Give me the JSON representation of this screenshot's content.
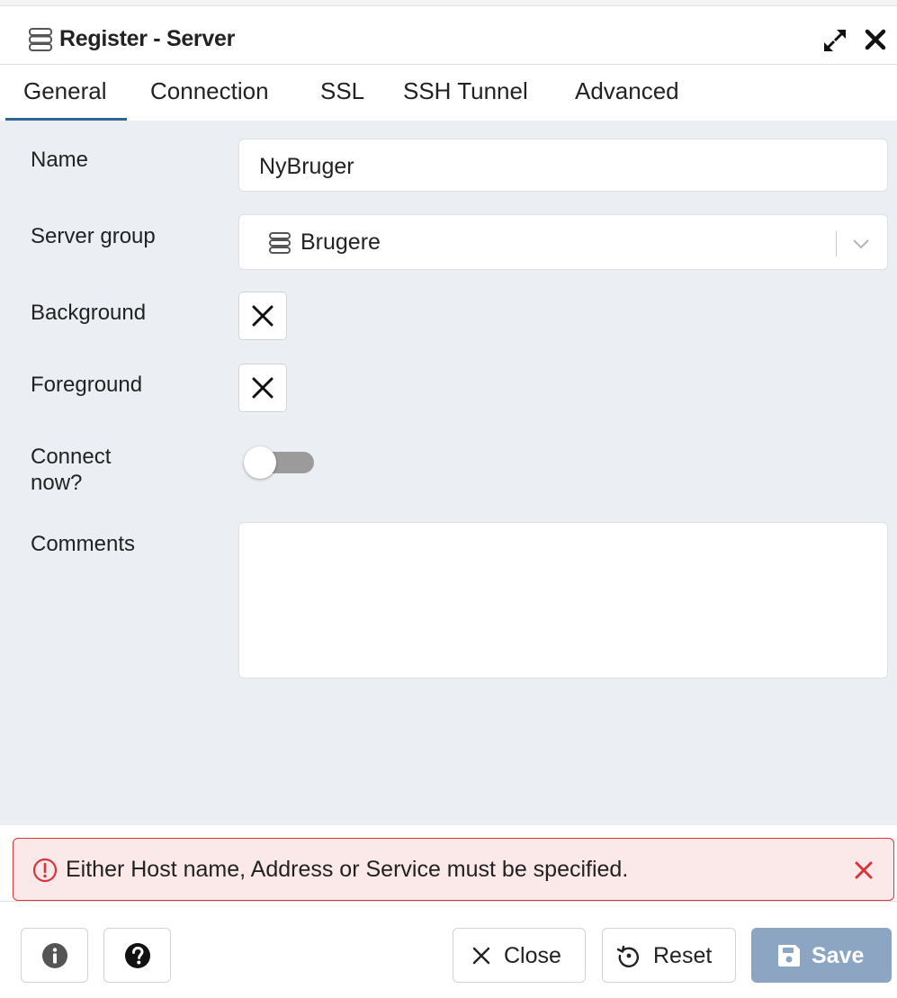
{
  "dialog": {
    "title": "Register - Server",
    "title_icon": "server-icon",
    "controls": [
      "expand-icon",
      "close-icon"
    ]
  },
  "tabs": [
    {
      "label": "General",
      "active": true
    },
    {
      "label": "Connection",
      "active": false
    },
    {
      "label": "SSL",
      "active": false
    },
    {
      "label": "SSH Tunnel",
      "active": false
    },
    {
      "label": "Advanced",
      "active": false
    }
  ],
  "form": {
    "name_label": "Name",
    "name_value": "NyBruger",
    "server_group_label": "Server group",
    "server_group_value": "Brugere",
    "background_label": "Background",
    "foreground_label": "Foreground",
    "connect_now_label_line1": "Connect",
    "connect_now_label_line2": "now?",
    "connect_now_value": false,
    "comments_label": "Comments",
    "comments_value": ""
  },
  "error": {
    "message": "Either Host name, Address or Service must be specified.",
    "color": "#d8343a"
  },
  "footer": {
    "info_icon": "info-icon",
    "help_icon": "help-icon",
    "close_label": "Close",
    "reset_label": "Reset",
    "save_label": "Save"
  },
  "colors": {
    "accent": "#326690",
    "save_button": "#8ba5c2",
    "body_bg": "#ebeef3"
  }
}
